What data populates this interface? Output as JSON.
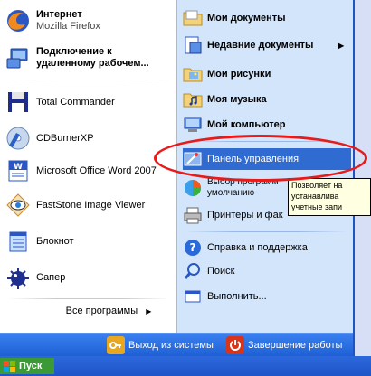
{
  "left_pinned": [
    {
      "title": "Интернет",
      "subtitle": "Mozilla Firefox",
      "icon": "firefox-icon"
    },
    {
      "title": "Подключение к удаленному рабочем...",
      "icon": "remote-desktop-icon"
    }
  ],
  "left_recent": [
    {
      "label": "Total Commander",
      "icon": "floppy-disk-icon"
    },
    {
      "label": "CDBurnerXP",
      "icon": "cd-burner-icon"
    },
    {
      "label": "Microsoft Office Word 2007",
      "icon": "word-icon"
    },
    {
      "label": "FastStone Image Viewer",
      "icon": "eye-icon"
    },
    {
      "label": "Блокнот",
      "icon": "notepad-icon"
    },
    {
      "label": "Сапер",
      "icon": "minesweeper-icon"
    }
  ],
  "all_programs": "Все программы",
  "right_items": [
    {
      "label": "Мои документы",
      "icon": "folder-icon"
    },
    {
      "label": "Недавние документы",
      "icon": "recent-documents-icon"
    },
    {
      "label": "Мои рисунки",
      "icon": "pictures-folder-icon"
    },
    {
      "label": "Моя музыка",
      "icon": "music-folder-icon"
    },
    {
      "label": "Мой компьютер",
      "icon": "computer-icon"
    },
    {
      "label": "Панель управления",
      "icon": "control-panel-icon"
    },
    {
      "label_line1": "Выбор программ",
      "label_line2": "умолчанию",
      "icon": "default-programs-icon"
    },
    {
      "label": "Принтеры и фак",
      "icon": "printer-icon"
    },
    {
      "label": "Справка и поддержка",
      "icon": "help-icon"
    },
    {
      "label": "Поиск",
      "icon": "search-icon"
    },
    {
      "label": "Выполнить...",
      "icon": "run-icon"
    }
  ],
  "tooltip": {
    "line1": "Позволяет на",
    "line2": "устанавлива",
    "line3": "учетные запи"
  },
  "bottom": {
    "logoff": "Выход из системы",
    "shutdown": "Завершение работы"
  },
  "taskbar": {
    "start": "Пуск"
  }
}
